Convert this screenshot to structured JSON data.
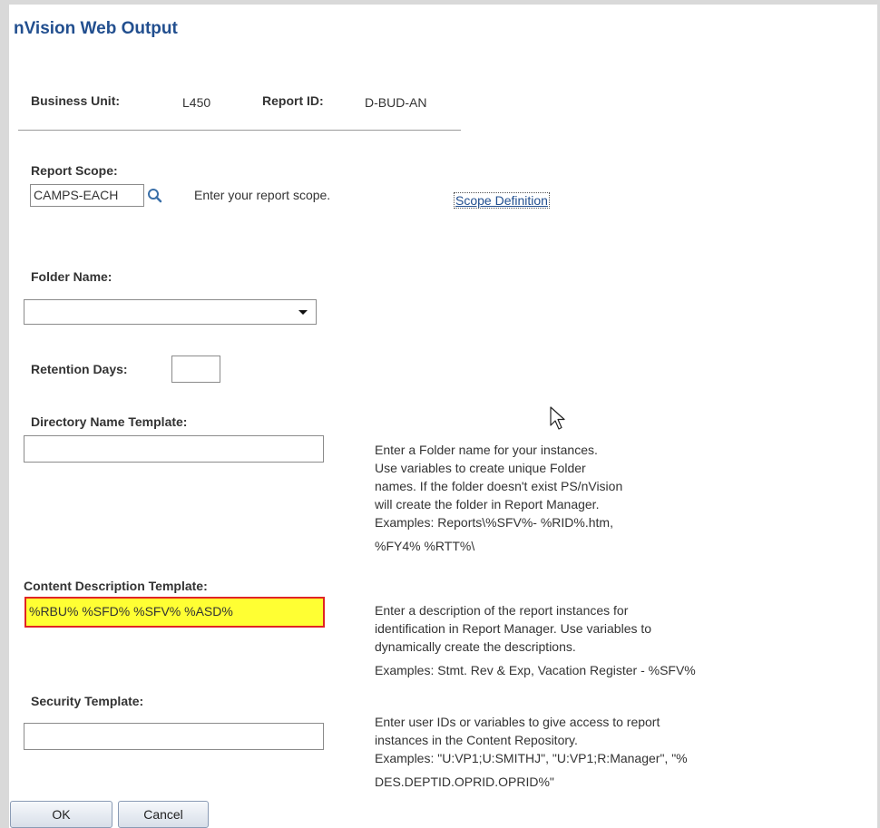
{
  "page": {
    "title": "nVision Web Output"
  },
  "header": {
    "business_unit_label": "Business Unit:",
    "business_unit_value": "L450",
    "report_id_label": "Report ID:",
    "report_id_value": "D-BUD-AN"
  },
  "report_scope": {
    "label": "Report Scope:",
    "value": "CAMPS-EACH",
    "hint": "Enter your report scope.",
    "link": "Scope Definition"
  },
  "folder_name": {
    "label": "Folder Name:",
    "value": ""
  },
  "retention_days": {
    "label": "Retention Days:",
    "value": ""
  },
  "directory_template": {
    "label": "Directory Name Template:",
    "value": "",
    "help": [
      "Enter a Folder name for your instances.",
      "Use variables to create unique Folder",
      "names. If the folder doesn't exist PS/nVision",
      "will create the folder in Report Manager.",
      "Examples: Reports\\%SFV%- %RID%.htm,",
      "%FY4% %RTT%\\"
    ]
  },
  "content_template": {
    "label": "Content Description Template:",
    "value": "%RBU% %SFD% %SFV% %ASD%",
    "help": [
      "Enter a description of the report instances for",
      "identification in Report Manager. Use variables to",
      "dynamically create the descriptions.",
      "Examples: Stmt. Rev & Exp, Vacation Register - %SFV%"
    ]
  },
  "security_template": {
    "label": "Security Template:",
    "value": "",
    "help": [
      "Enter user IDs or variables to give access to report",
      "instances in the Content Repository.",
      "Examples: \"U:VP1;U:SMITHJ\", \"U:VP1;R:Manager\", \"%",
      "DES.DEPTID.OPRID.OPRID%\""
    ]
  },
  "buttons": {
    "ok": "OK",
    "cancel": "Cancel"
  },
  "icons": {
    "lookup": "magnifier-lookup-icon",
    "dropdown": "chevron-down-icon",
    "cursor": "mouse-pointer-icon"
  },
  "colors": {
    "title": "#224f8f",
    "highlight_fill": "#ffff33",
    "highlight_border": "#e02424"
  }
}
